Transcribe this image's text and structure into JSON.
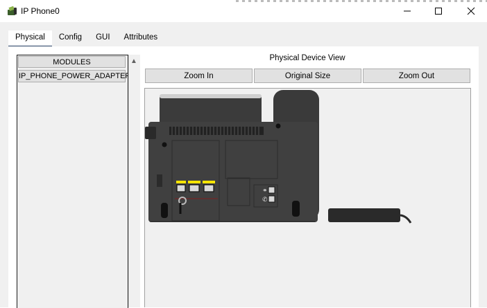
{
  "window": {
    "title": "IP Phone0",
    "minimize_icon": "minimize-icon",
    "maximize_icon": "maximize-icon",
    "close_icon": "close-icon",
    "app_icon": "ip-phone-app-icon"
  },
  "tabs": [
    {
      "label": "Physical",
      "active": true
    },
    {
      "label": "Config",
      "active": false
    },
    {
      "label": "GUI",
      "active": false
    },
    {
      "label": "Attributes",
      "active": false
    }
  ],
  "modules": {
    "header": "MODULES",
    "items": [
      "IP_PHONE_POWER_ADAPTER"
    ]
  },
  "device_view": {
    "title": "Physical Device View",
    "buttons": {
      "zoom_in": "Zoom In",
      "original_size": "Original Size",
      "zoom_out": "Zoom Out"
    },
    "device": "ip-phone-rear-view",
    "port_labels": [
      "",
      "",
      ""
    ]
  },
  "colors": {
    "tab_underline": "#1f3a5f",
    "phone_body": "#3a3a3a",
    "port_label": "#f5e400"
  }
}
